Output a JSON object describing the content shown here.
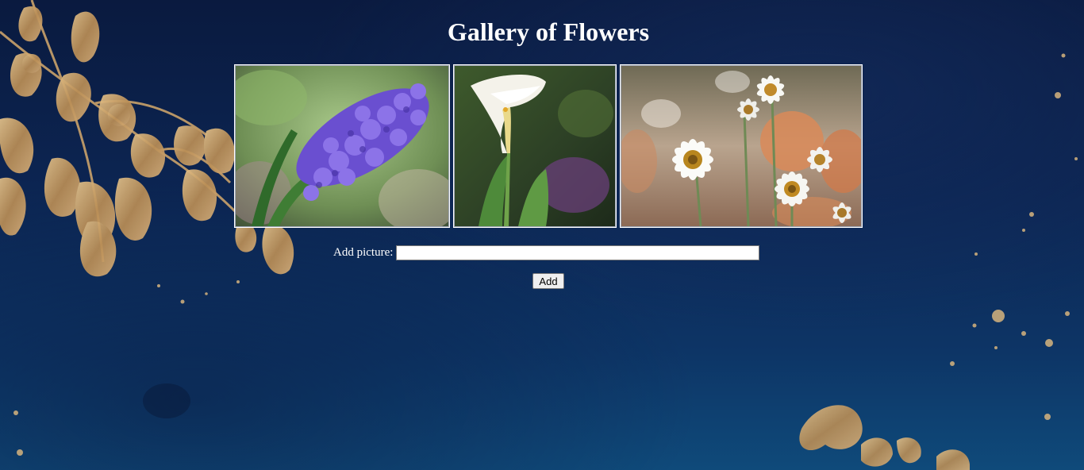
{
  "page": {
    "title": "Gallery of Flowers"
  },
  "gallery": {
    "images": [
      {
        "subject": "purple hyacinth"
      },
      {
        "subject": "white calla lily"
      },
      {
        "subject": "white daisies"
      }
    ]
  },
  "form": {
    "label": "Add picture:",
    "input_value": "",
    "button_label": "Add"
  },
  "colors": {
    "background": "#0c2552",
    "gold_accent": "#c9a46a",
    "text": "#ffffff"
  }
}
